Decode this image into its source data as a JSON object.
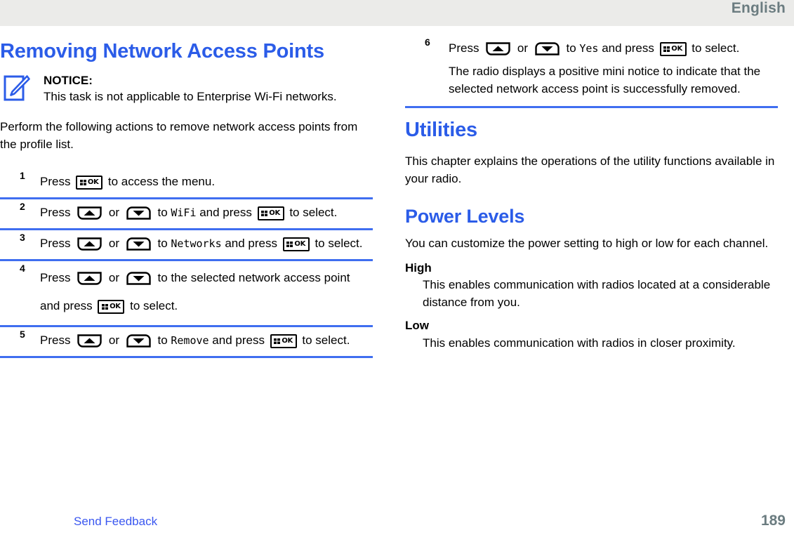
{
  "header": {
    "language": "English"
  },
  "left_column": {
    "chapter_title": "Removing Network Access Points",
    "notice": {
      "icon": "notice-pencil-icon",
      "title": "NOTICE:",
      "body": "This task is not applicable to Enterprise Wi-Fi networks."
    },
    "intro": "Perform the following actions to remove network access points from the profile list.",
    "steps": [
      {
        "number": "1",
        "parts": [
          {
            "type": "text",
            "value": "Press "
          },
          {
            "type": "key",
            "value": "ok-key"
          },
          {
            "type": "text",
            "value": " to access the menu."
          }
        ]
      },
      {
        "number": "2",
        "parts": [
          {
            "type": "text",
            "value": "Press "
          },
          {
            "type": "key",
            "value": "up-key"
          },
          {
            "type": "text",
            "value": " or "
          },
          {
            "type": "key",
            "value": "down-key"
          },
          {
            "type": "text",
            "value": " to "
          },
          {
            "type": "display",
            "value": "WiFi"
          },
          {
            "type": "text",
            "value": " and press "
          },
          {
            "type": "key",
            "value": "ok-key"
          },
          {
            "type": "text",
            "value": " to select."
          }
        ]
      },
      {
        "number": "3",
        "parts": [
          {
            "type": "text",
            "value": "Press "
          },
          {
            "type": "key",
            "value": "up-key"
          },
          {
            "type": "text",
            "value": " or "
          },
          {
            "type": "key",
            "value": "down-key"
          },
          {
            "type": "text",
            "value": " to "
          },
          {
            "type": "display",
            "value": "Networks"
          },
          {
            "type": "text",
            "value": " and press "
          },
          {
            "type": "key",
            "value": "ok-key"
          },
          {
            "type": "text",
            "value": " to select."
          }
        ]
      },
      {
        "number": "4",
        "parts": [
          {
            "type": "text",
            "value": "Press "
          },
          {
            "type": "key",
            "value": "up-key"
          },
          {
            "type": "text",
            "value": " or "
          },
          {
            "type": "key",
            "value": "down-key"
          },
          {
            "type": "text",
            "value": " to the selected network access point and press "
          },
          {
            "type": "key",
            "value": "ok-key"
          },
          {
            "type": "text",
            "value": " to select."
          }
        ]
      },
      {
        "number": "5",
        "parts": [
          {
            "type": "text",
            "value": "Press "
          },
          {
            "type": "key",
            "value": "up-key"
          },
          {
            "type": "text",
            "value": " or "
          },
          {
            "type": "key",
            "value": "down-key"
          },
          {
            "type": "text",
            "value": " to "
          },
          {
            "type": "display",
            "value": "Remove"
          },
          {
            "type": "text",
            "value": " and press "
          },
          {
            "type": "key",
            "value": "ok-key"
          },
          {
            "type": "text",
            "value": " to select."
          }
        ]
      }
    ]
  },
  "right_column": {
    "steps": [
      {
        "number": "6",
        "parts": [
          {
            "type": "text",
            "value": "Press "
          },
          {
            "type": "key",
            "value": "up-key"
          },
          {
            "type": "text",
            "value": " or "
          },
          {
            "type": "key",
            "value": "down-key"
          },
          {
            "type": "text",
            "value": " to "
          },
          {
            "type": "display",
            "value": "Yes"
          },
          {
            "type": "text",
            "value": " and press "
          },
          {
            "type": "key",
            "value": "ok-key"
          },
          {
            "type": "text",
            "value": " to select."
          }
        ],
        "note": "The radio displays a positive mini notice to indicate that the selected network access point is successfully removed."
      }
    ],
    "chapter_title": "Utilities",
    "chapter_intro": "This chapter explains the operations of the utility functions available in your radio.",
    "section_title": "Power Levels",
    "section_intro": "You can customize the power setting to high or low for each channel.",
    "definitions": [
      {
        "term": "High",
        "definition": "This enables communication with radios located at a considerable distance from you."
      },
      {
        "term": "Low",
        "definition": "This enables communication with radios in closer proximity."
      }
    ]
  },
  "footer": {
    "feedback_label": "Send Feedback",
    "page_number": "189"
  },
  "colors": {
    "heading_blue": "#2b5ce8",
    "rule_blue": "#3f6ef0",
    "link_blue": "#3a57f0",
    "header_gray": "#6b7c80",
    "header_band": "#ebebe9"
  }
}
